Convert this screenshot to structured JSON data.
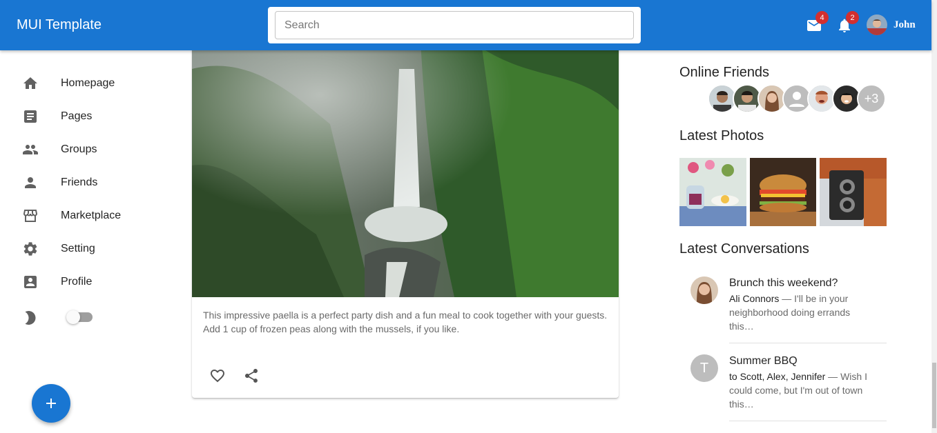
{
  "app": {
    "title": "MUI Template"
  },
  "search": {
    "placeholder": "Search"
  },
  "header": {
    "mail_badge": "4",
    "notifications_badge": "2",
    "user_name": "John"
  },
  "sidebar": {
    "items": [
      {
        "label": "Homepage",
        "icon": "home-icon"
      },
      {
        "label": "Pages",
        "icon": "article-icon"
      },
      {
        "label": "Groups",
        "icon": "group-icon"
      },
      {
        "label": "Friends",
        "icon": "person-icon"
      },
      {
        "label": "Marketplace",
        "icon": "storefront-icon"
      },
      {
        "label": "Setting",
        "icon": "gear-icon"
      },
      {
        "label": "Profile",
        "icon": "account-box-icon"
      }
    ],
    "dark_mode_on": false
  },
  "post": {
    "text": "This impressive paella is a perfect party dish and a fun meal to cook together with your guests. Add 1 cup of frozen peas along with the mussels, if you like."
  },
  "rightbar": {
    "online_friends_title": "Online Friends",
    "more_friends": "+3",
    "latest_photos_title": "Latest Photos",
    "latest_conversations_title": "Latest Conversations",
    "conversations": [
      {
        "title": "Brunch this weekend?",
        "from": "Ali Connors",
        "snippet": " — I'll be in your neighborhood doing errands this…"
      },
      {
        "title": "Summer BBQ",
        "from": "to Scott, Alex, Jennifer",
        "snippet": " — Wish I could come, but I'm out of town this…",
        "initial": "T"
      }
    ]
  },
  "colors": {
    "primary": "#1976d2",
    "badge": "#d32f2f"
  }
}
